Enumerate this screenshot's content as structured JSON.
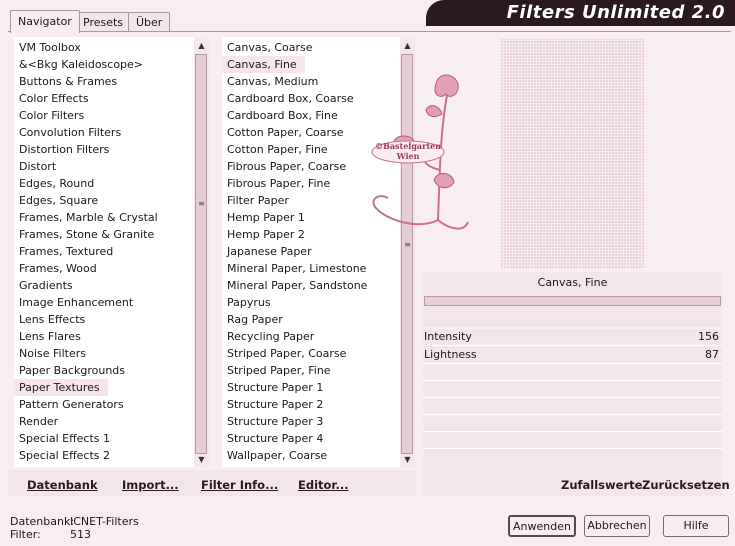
{
  "tabs": [
    "Navigator",
    "Presets",
    "Über"
  ],
  "app_title": "Filters Unlimited 2.0",
  "categories": [
    "VM Toolbox",
    "&<Bkg Kaleidoscope>",
    "Buttons & Frames",
    "Color Effects",
    "Color Filters",
    "Convolution Filters",
    "Distortion Filters",
    "Distort",
    "Edges, Round",
    "Edges, Square",
    "Frames, Marble & Crystal",
    "Frames, Stone & Granite",
    "Frames, Textured",
    "Frames, Wood",
    "Gradients",
    "Image Enhancement",
    "Lens Effects",
    "Lens Flares",
    "Noise Filters",
    "Paper Backgrounds",
    "Paper Textures",
    "Pattern Generators",
    "Render",
    "Special Effects 1",
    "Special Effects 2"
  ],
  "selected_category_index": 20,
  "filters": [
    "Canvas, Coarse",
    "Canvas, Fine",
    "Canvas, Medium",
    "Cardboard Box, Coarse",
    "Cardboard Box, Fine",
    "Cotton Paper, Coarse",
    "Cotton Paper, Fine",
    "Fibrous Paper, Coarse",
    "Fibrous Paper, Fine",
    "Filter Paper",
    "Hemp Paper 1",
    "Hemp Paper 2",
    "Japanese Paper",
    "Mineral Paper, Limestone",
    "Mineral Paper, Sandstone",
    "Papyrus",
    "Rag Paper",
    "Recycling Paper",
    "Striped Paper, Coarse",
    "Striped Paper, Fine",
    "Structure Paper 1",
    "Structure Paper 2",
    "Structure Paper 3",
    "Structure Paper 4",
    "Wallpaper, Coarse"
  ],
  "selected_filter_index": 1,
  "preview": {
    "watermark_line1": "©Bastelgarten",
    "watermark_line2": "Wien"
  },
  "current_filter": "Canvas, Fine",
  "params": [
    {
      "label": "Intensity",
      "value": "156"
    },
    {
      "label": "Lightness",
      "value": "87"
    }
  ],
  "actions": {
    "database": "Datenbank",
    "import": "Import...",
    "filter_info": "Filter Info...",
    "editor": "Editor...",
    "randomize": "Zufallswerte",
    "reset": "Zurücksetzen"
  },
  "info": {
    "database_label": "Datenbank:",
    "database_value": "ICNET-Filters",
    "filter_label": "Filter:",
    "filter_value": "513"
  },
  "buttons": {
    "apply": "Anwenden",
    "cancel": "Abbrechen",
    "help": "Hilfe"
  },
  "colors": {
    "background": "#f8eef1",
    "accent": "#2a1a20",
    "selection": "#f6e6ea"
  }
}
